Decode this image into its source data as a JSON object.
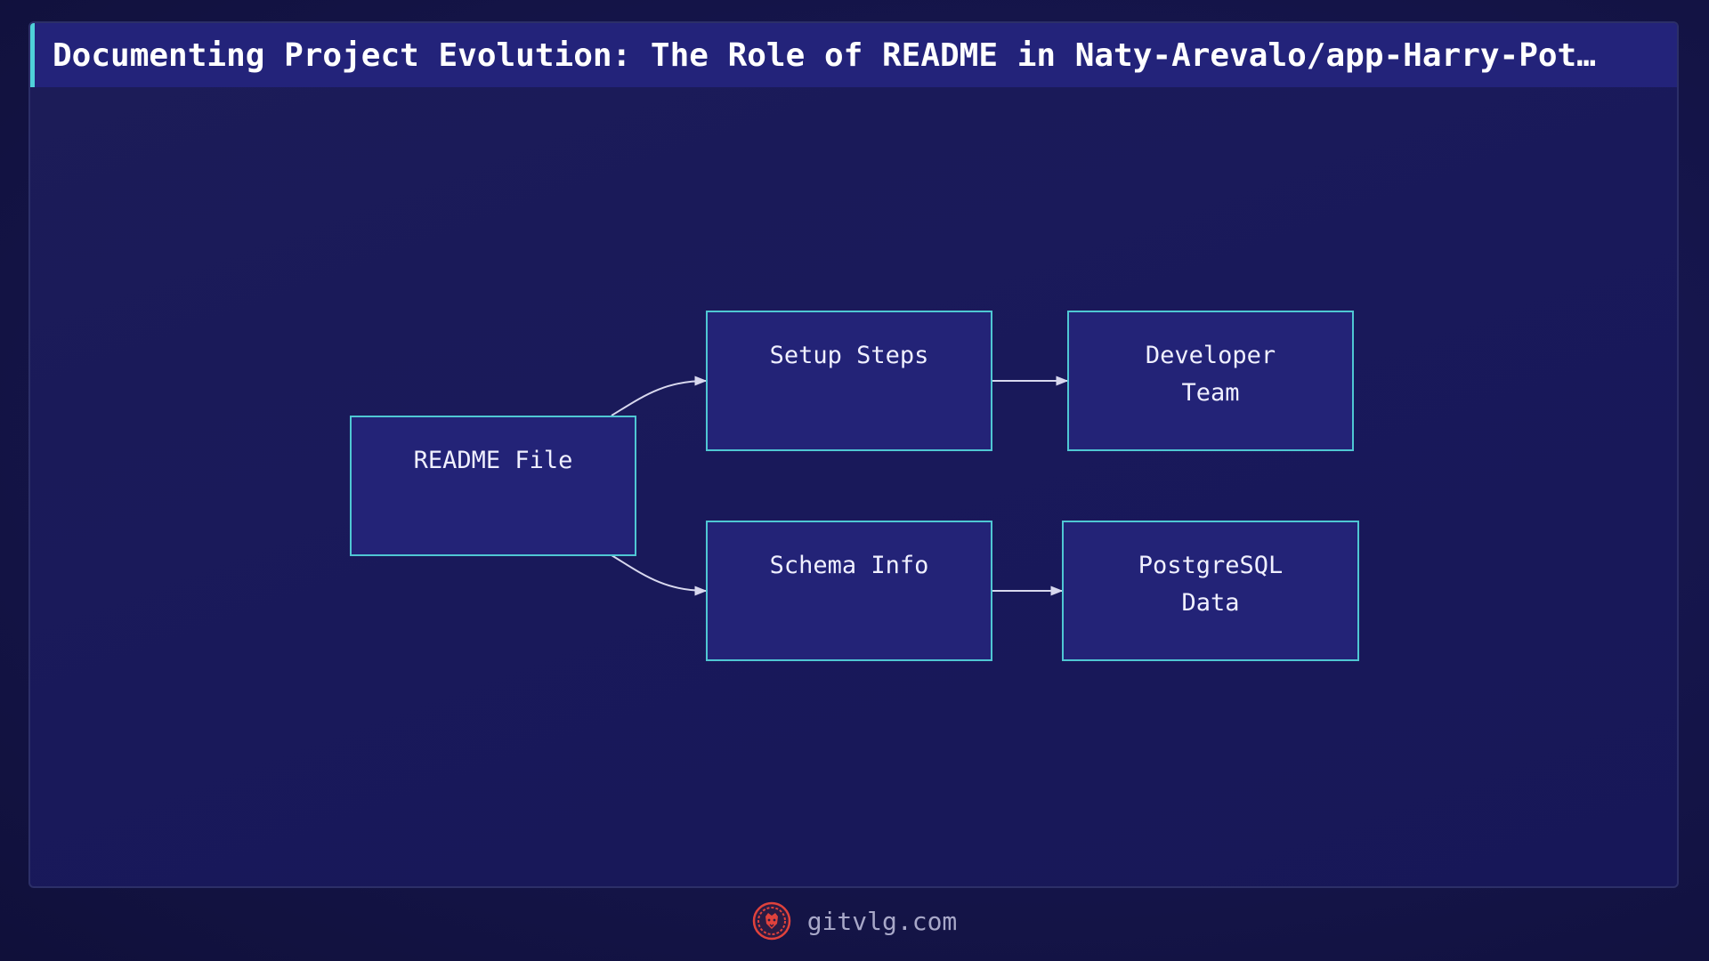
{
  "header": {
    "title": "Documenting Project Evolution: The Role of README in Naty-Arevalo/app-Harry-Pot…"
  },
  "diagram": {
    "nodes": {
      "readme": {
        "lines": [
          "README File"
        ]
      },
      "setup": {
        "lines": [
          "Setup Steps"
        ]
      },
      "schema": {
        "lines": [
          "Schema Info"
        ]
      },
      "developer": {
        "lines": [
          "Developer",
          "Team"
        ]
      },
      "postgres": {
        "lines": [
          "PostgreSQL",
          "Data"
        ]
      }
    },
    "edges": [
      {
        "from": "readme",
        "to": "setup"
      },
      {
        "from": "readme",
        "to": "schema"
      },
      {
        "from": "setup",
        "to": "developer"
      },
      {
        "from": "schema",
        "to": "postgres"
      }
    ]
  },
  "footer": {
    "site": "gitvlg.com",
    "logo_icon": "lion-head-icon"
  },
  "colors": {
    "accent": "#4fd1d9",
    "node_fill": "#232377",
    "logo": "#e0423c"
  }
}
